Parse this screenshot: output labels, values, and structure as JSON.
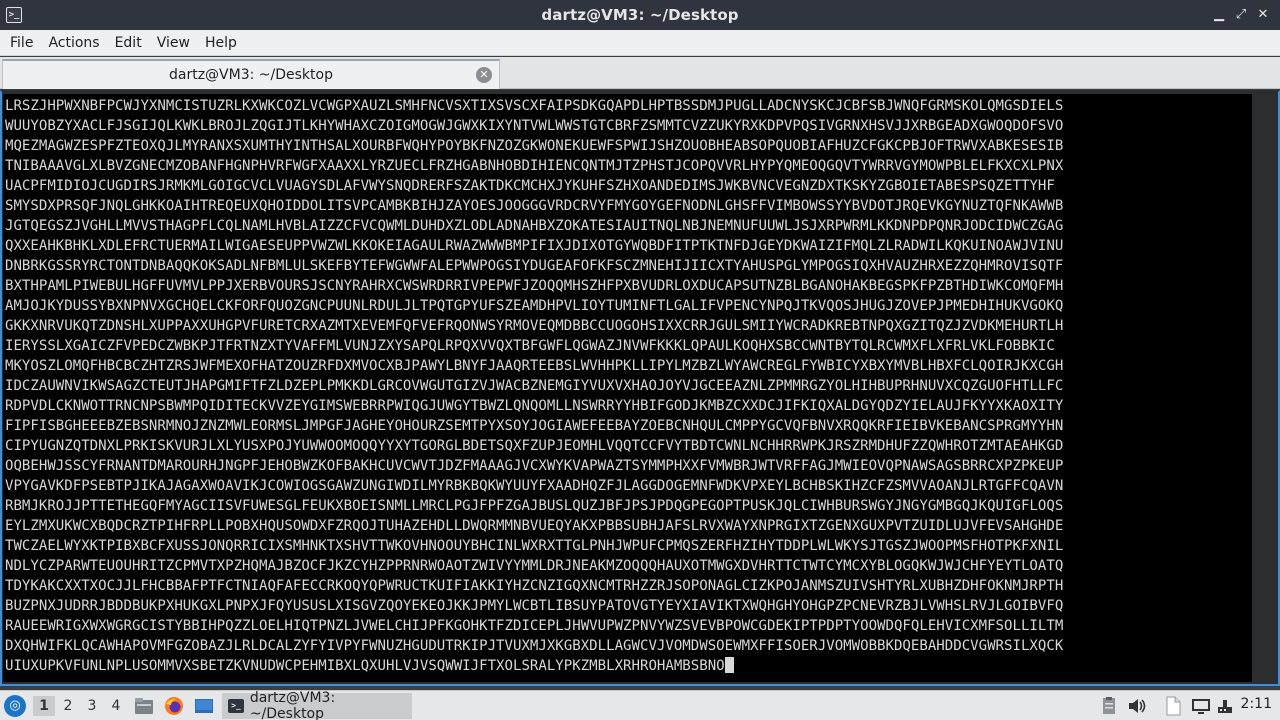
{
  "window": {
    "title": "dartz@VM3: ~/Desktop",
    "controls": {
      "minimize": "▁",
      "maximize": "⤢",
      "close": "✕"
    }
  },
  "menu": [
    "File",
    "Actions",
    "Edit",
    "View",
    "Help"
  ],
  "tab": {
    "label": "dartz@VM3: ~/Desktop",
    "close": "✕"
  },
  "terminal": {
    "lines": [
      "LRSZJHPWXNBFPCWJYXNMCISTUZRLKXWKCOZLVCWGPXAUZLSMHFNCVSXTIXSVSCXFAIPSDKGQAPDLHPTBSSDMJPUGLLADCNYSKCJCBFSBJWNQFGRMSKOLQMGSDIELS",
      "WUUYOBZYXACLFJSGIJQLKWKLBROJLZQGIJTLKHYWHAXCZOIGMOGWJGWXKIXYNTVWLWWSTGTCBRFZSMMTCVZZUKYRXKDPVPQSIVGRNXHSVJJXRBGEADXGWOQDOFSVO",
      "MQEZMAGWZESPFZTEOXQJLMYRANXSXUMTHYINTHSALXOURBFWQHYPOYBKFNZOZGKWONEKUEWFSPWIJSHZOUOBHEABSOPQUOBIAFHUZCFGKCPBJOFTRWVXABKESESIB",
      "TNIBAAAVGLXLBVZGNECMZOBANFHGNPHVRFWGFXAAXXLYRZUECLFRZHGABNHOBDIHIENCQNTMJTZPHSTJCOPQVVRLHYPYQMEOQGQVTYWRRVGYMOWPBLELFKXCXLPNX",
      "UACPFMIDIOJCUGDIRSJRMKMLGOIGCVCLVUAGYSDLAFVWYSNQDRERFSZAKTDKCMCHXJYKUHFSZHXOANDEDIMSJWKBVNCVEGNZDXTKSKYZGBOIETABESPSQZETTYHF",
      "SMYSDXPRSQFJNQLGHKKOAIHTREQEUXQHOIDDOLITSVPCAMBKBIHJZAYOESJOOGGGVRDCRVYFMYGOYGEFNODNLGHSFFVIMBOWSSYYBVDOTJRQEVKGYNUZTQFNKAWWB",
      "JGTQEGSZJVGHLLMVVSTHAGPFLCQLNAMLHVBLAIZZCFVCQWMLDUHDXZLODLADNAHBXZOKATESIAUITNQLNBJNEMNUFUUWLJSJXRPWRMLKKDNPDPQNRJODCIDWCZGAG",
      "QXXEAHKBHKLXDLEFRCTUERMAILWIGAESEUPPVWZWLKKOKEIAGAULRWAZWWWBMPIFIXJDIXOTGYWQBDFITPTKTNFDJGEYDKWAIZIFMQLZLRADWILKQKUINOAWJVINU",
      "DNBRKGSSRYRCTONTDNBAQQKOKSADLNFBMLULSKEFBYTEFWGWWFALEPWWPOGSIYDUGEAFOFKFSCZMNEHIJIICXTYAHUSPGLYMPOGSIQXHVAUZHRXEZZQHMROVISQTF",
      "BXTHPAMLPIWEBULHGFFUVMVLPPJXERBVOURSJSCNYRAHRXCWSWRDRRIVPEPWFJZOQQMHSZHFPXBVUDRLOXDUCAPSUTNZBLBGANOHAKBEGSPKFPZBTHDIWKCOMQFMH",
      "AMJOJKYDUSSYBXNPNVXGCHQELCKFORFQUOZGNCPUUNLRDULJLTPQTGPYUFSZEAMDHPVLIOYTUMINFTLGALIFVPENCYNPQJTKVQOSJHUGJZOVEPJPMEDHIHUKVGOKQ",
      "GKKXNRVUKQTZDNSHLXUPPAXXUHGPVFURETCRXAZMTXEVEMFQFVEFRQONWSYRMOVEQMDBBCCUOGOHSIXXCRRJGULSMIIYWCRADKREBTNPQXGZITQZJZVDKMEHURTLH",
      "IERYSSLXGAICZFVPEDCZWBKPJTFRTNZXTYVAFFMLVUNJZXYSAPQLRPQXVVQXTBFGWFLQGWAZJNVWFKKKLQPAULKOQHXSBCCWNTBYTQLRCWMXFLXFRLVKLFOBBKIC",
      "MKYOSZLOMQFHBCBCZHTZRSJWFMEXOFHATZOUZRFDXMVOCXBJPAWYLBNYFJAAQRTEEBSLWVHHPKLLIPYLMZBZLWYAWCREGLFYWBICYXBXYMVBLHBXFCLQOIRJKXCGH",
      "IDCZAUWNVIKWSAGZCTEUTJHAPGMIFTFZLDZEPLPMKKDLGRCOVWGUTGIZVJWACBZNEMGIYVUXVXHAOJOYVJGCEEAZNLZPMMRGZYOLHIHBUPRHNUVXCQZGUOFHTLLFC",
      "RDPVDLCKNWOTTRNCNPSBWMPQIDITECKVVZEYGIMSWEBRRPWIQGJUWGYTBWZLQNQOMLLNSWRRYYHBIFGODJKMBZCXXDCJIFKIQXALDGYQDZYIELAUJFKYYXKAOXITY",
      "FIPFISBGHEEEBZEBSNRMNOJZNZMWLEORMSLJMPGFJAGHEYOHOURZSEMTPYXSOYJOGIAWEFEEBAYZOEBCNHQULCMPPYGCVQFBNVXRQQKRFIEIBVKEBANCSPRGMYYHN",
      "CIPYUGNZQTDNXLPRKISKVURJLXLYUSXPOJYUWWOOMOQQYYXYTGORGLBDETSQXFZUPJEOMHLVQQTCCFVYTBDTCWNLNCHHRRWPKJRSZRMDHUFZZQWHROTZMTAEAHKGD",
      "OQBEHWJSSCYFRNANTDMAROURHJNGPFJEHOBWZKOFBAKHCUVCWVTJDZFMAAAGJVCXWYKVAPWAZTSYMMPHXXFVMWBRJWTVRFFAGJMWIEOVQPNAWSAGSBRRCXPZPKEUP",
      "VPYGAVKDFPSEBTPJIKAJAGAXWOAVIKJCOWIOGSGAWZUNGIWDILMYRBKBQKWYUUYFXAADHQZFJLAGGDOGEMNFWDKVPXEYLBCHBSKIHZCFZSMVVAOANJLRTGFFCQAVN",
      "RBMJKROJJPTTETHEGQFMYAGCIISVFUWESGLFEUKXBOEISNMLLMRCLPGJFPFZGAJBUSLQUZJBFJPSJPDQGPEGOPTPUSKJQLCIWHBURSWGYJNGYGMBGQJKQUIGFLOQS",
      "EYLZMXUKWCXBQDCRZTPIHFRPLLPOBXHQUSOWDXFZRQOJTUHAZEHDLLDWQRMMNBVUEQYAKXPBBSUBHJAFSLRVXWAYXNPRGIXTZGENXGUXPVTZUIDLUJVFEVSAHGHDE",
      "TWCZAELWYXKTPIBXBCFXUSSJONQRRICIXSMHNKTXSHVTTWKOVHNOOUYBHCINLWXRXTTGLPNHJWPUFCPMQSZERFHZIHYTDDPLWLWKYSJTGSZJWOOPMSFHOTPKFXNIL",
      "NDLYCZPARWTEUOUHRITZCPMVTXPZHQMAJBZOCFJKZCYHZPPRNRWOAOTZWIVYYMMLDRJNEAKMZOQQQHAUXOTMWGXDVHRTTCTWTCYMCXYBLOGQKWJWJCHFYEYTLOATQ",
      "TDYKAKCXXTXOCJJLFHCBBAFPTFCTNIAQFAFECCRKOQYQPWRUCTKUIFIAKKIYHZCNZIGQXNCMTRHZZRJSOPONAGLCIZKPOJANMSZUIVSHTYRLXUBHZDHFOKNMJRPTH",
      "BUZPNXJUDRRJBDDBUKPXHUKGXLPNPXJFQYUSUSLXISGVZQOYEKEOJKKJPMYLWCBTLIBSUYPATOVGTYEYXIAVIKTXWQHGHYOHGPZPCNEVRZBJLVWHSLRVJLGOIBVFQ",
      "RAUEEWRIGXWXWGRGCISTYBBIHPQZZLOELHIQTPNZLJVWELCHIJPFKGOHKTFZDICEPLJHWVUPWZPNVYWZSVEVBPOWCGDEKIPTPDPTYOOWDQFQLEHVICXMFSOLLILTM",
      "DXQHWIFKLQCAWHAPOVMFGZOBAZJLRLDCALZYFYIVPYFWNUZHGUDUTRKIPJTVUXMJXKGBXDLLAGWCVJVOMDWSOEWMXFFISOERJVOMWOBBKDQEBAHDDCVGWRSILXQCK",
      "UIUXUPKVFUNLNPLUSOMMVXSBETZKVNUDWCPEHMIBXLQXUHLVJVSQWWIJFTXOLSRALYPKZMBLXRHROHAMBSBNO"
    ]
  },
  "taskbar": {
    "desktops": [
      "1",
      "2",
      "3",
      "4"
    ],
    "task_label": "dartz@VM3: ~/Desktop",
    "clock": "2:11"
  }
}
